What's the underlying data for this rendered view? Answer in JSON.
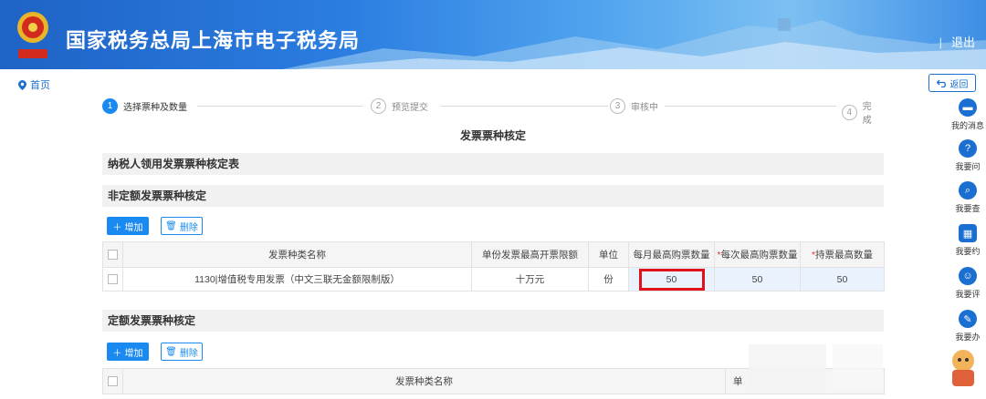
{
  "header": {
    "title": "国家税务总局上海市电子税务局",
    "logout_sep": "|",
    "logout": "退出"
  },
  "breadcrumb": {
    "home": "首页"
  },
  "back_label": "返回",
  "steps": [
    {
      "num": "1",
      "label": "选择票种及数量"
    },
    {
      "num": "2",
      "label": "预览提交"
    },
    {
      "num": "3",
      "label": "审核中"
    },
    {
      "num": "4",
      "label": "完成"
    }
  ],
  "page_title": "发票票种核定",
  "sections": {
    "taxpayer": "纳税人领用发票票种核定表",
    "non_fixed": "非定额发票票种核定",
    "fixed": "定额发票票种核定"
  },
  "buttons": {
    "add": "增加",
    "delete": "删除"
  },
  "non_fixed_table": {
    "headers": [
      "发票种类名称",
      "单份发票最高开票限额",
      "单位",
      "每月最高购票数量",
      "每次最高购票数量",
      "持票最高数量"
    ],
    "rows": [
      {
        "name": "1130|增值税专用发票（中文三联无金额限制版）",
        "limit": "十万元",
        "unit": "份",
        "monthly": "50",
        "per_time": "50",
        "max_hold": "50"
      }
    ]
  },
  "fixed_table": {
    "headers": [
      "发票种类名称",
      "单"
    ]
  },
  "sidebar": [
    {
      "label": "我的消息",
      "icon": "message-icon"
    },
    {
      "label": "我要问",
      "icon": "question-icon"
    },
    {
      "label": "我要查",
      "icon": "search-icon"
    },
    {
      "label": "我要约",
      "icon": "appointment-icon"
    },
    {
      "label": "我要评",
      "icon": "rate-icon"
    },
    {
      "label": "我要办",
      "icon": "edit-icon"
    }
  ],
  "colors": {
    "primary": "#1a8af0",
    "highlight_border": "#e0121b"
  }
}
